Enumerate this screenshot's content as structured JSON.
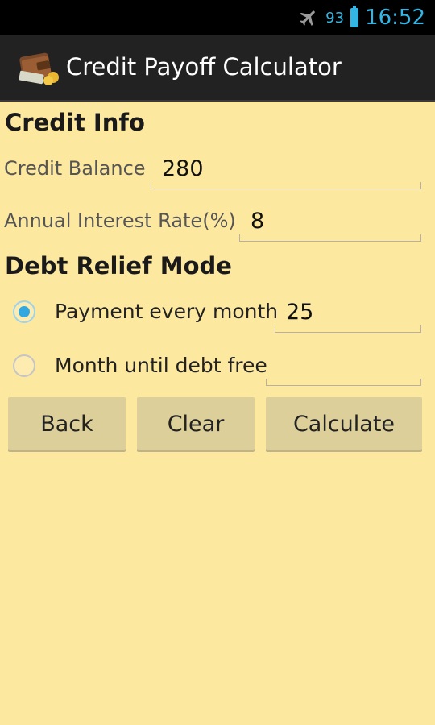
{
  "status_bar": {
    "battery_percent": "93",
    "time": "16:52",
    "accent_color": "#33b5e5"
  },
  "action_bar": {
    "title": "Credit Payoff Calculator",
    "icon": "wallet-icon"
  },
  "credit_info": {
    "heading": "Credit Info",
    "balance_label": "Credit Balance",
    "balance_value": "280",
    "rate_label": "Annual Interest Rate(%)",
    "rate_value": "8"
  },
  "debt_relief": {
    "heading": "Debt Relief Mode",
    "option_payment_label": "Payment every month",
    "option_payment_value": "25",
    "option_payment_selected": true,
    "option_months_label": "Month until debt free",
    "option_months_value": "",
    "option_months_selected": false
  },
  "buttons": {
    "back": "Back",
    "clear": "Clear",
    "calculate": "Calculate"
  },
  "colors": {
    "background": "#fde8a0",
    "action_bar": "#222222",
    "button": "#dccf99",
    "radio_selected": "#33a8e0"
  }
}
